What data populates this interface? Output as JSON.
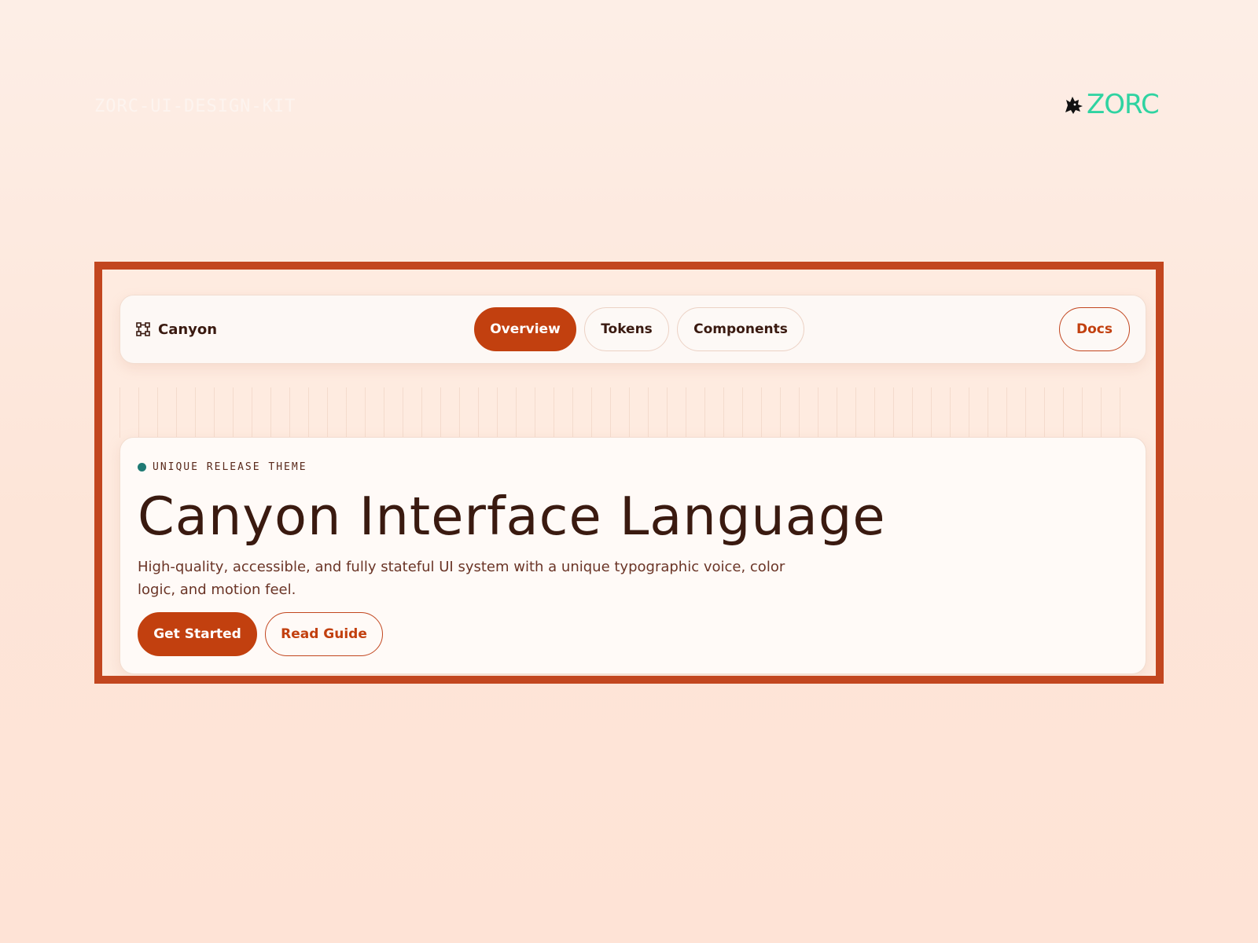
{
  "header": {
    "kit_label": "ZORC-UI-DESIGN-KIT",
    "logo_text": "ZORC",
    "logo_icon": "wolf-head-icon"
  },
  "colors": {
    "accent": "#c2400f",
    "frame_border": "#c2461f",
    "logo_green": "#2fd3a1",
    "status_dot": "#1f7a74",
    "text_dark": "#3a1a10"
  },
  "navbar": {
    "brand_icon": "frame-corners-icon",
    "brand_name": "Canyon",
    "tabs": [
      {
        "label": "Overview",
        "active": true
      },
      {
        "label": "Tokens",
        "active": false
      },
      {
        "label": "Components",
        "active": false
      }
    ],
    "docs_label": "Docs"
  },
  "hero": {
    "eyebrow": "UNIQUE RELEASE THEME",
    "title": "Canyon Interface Language",
    "description": "High-quality, accessible, and fully stateful UI system with a unique typographic voice, color logic, and motion feel.",
    "primary_cta": "Get Started",
    "secondary_cta": "Read Guide"
  }
}
